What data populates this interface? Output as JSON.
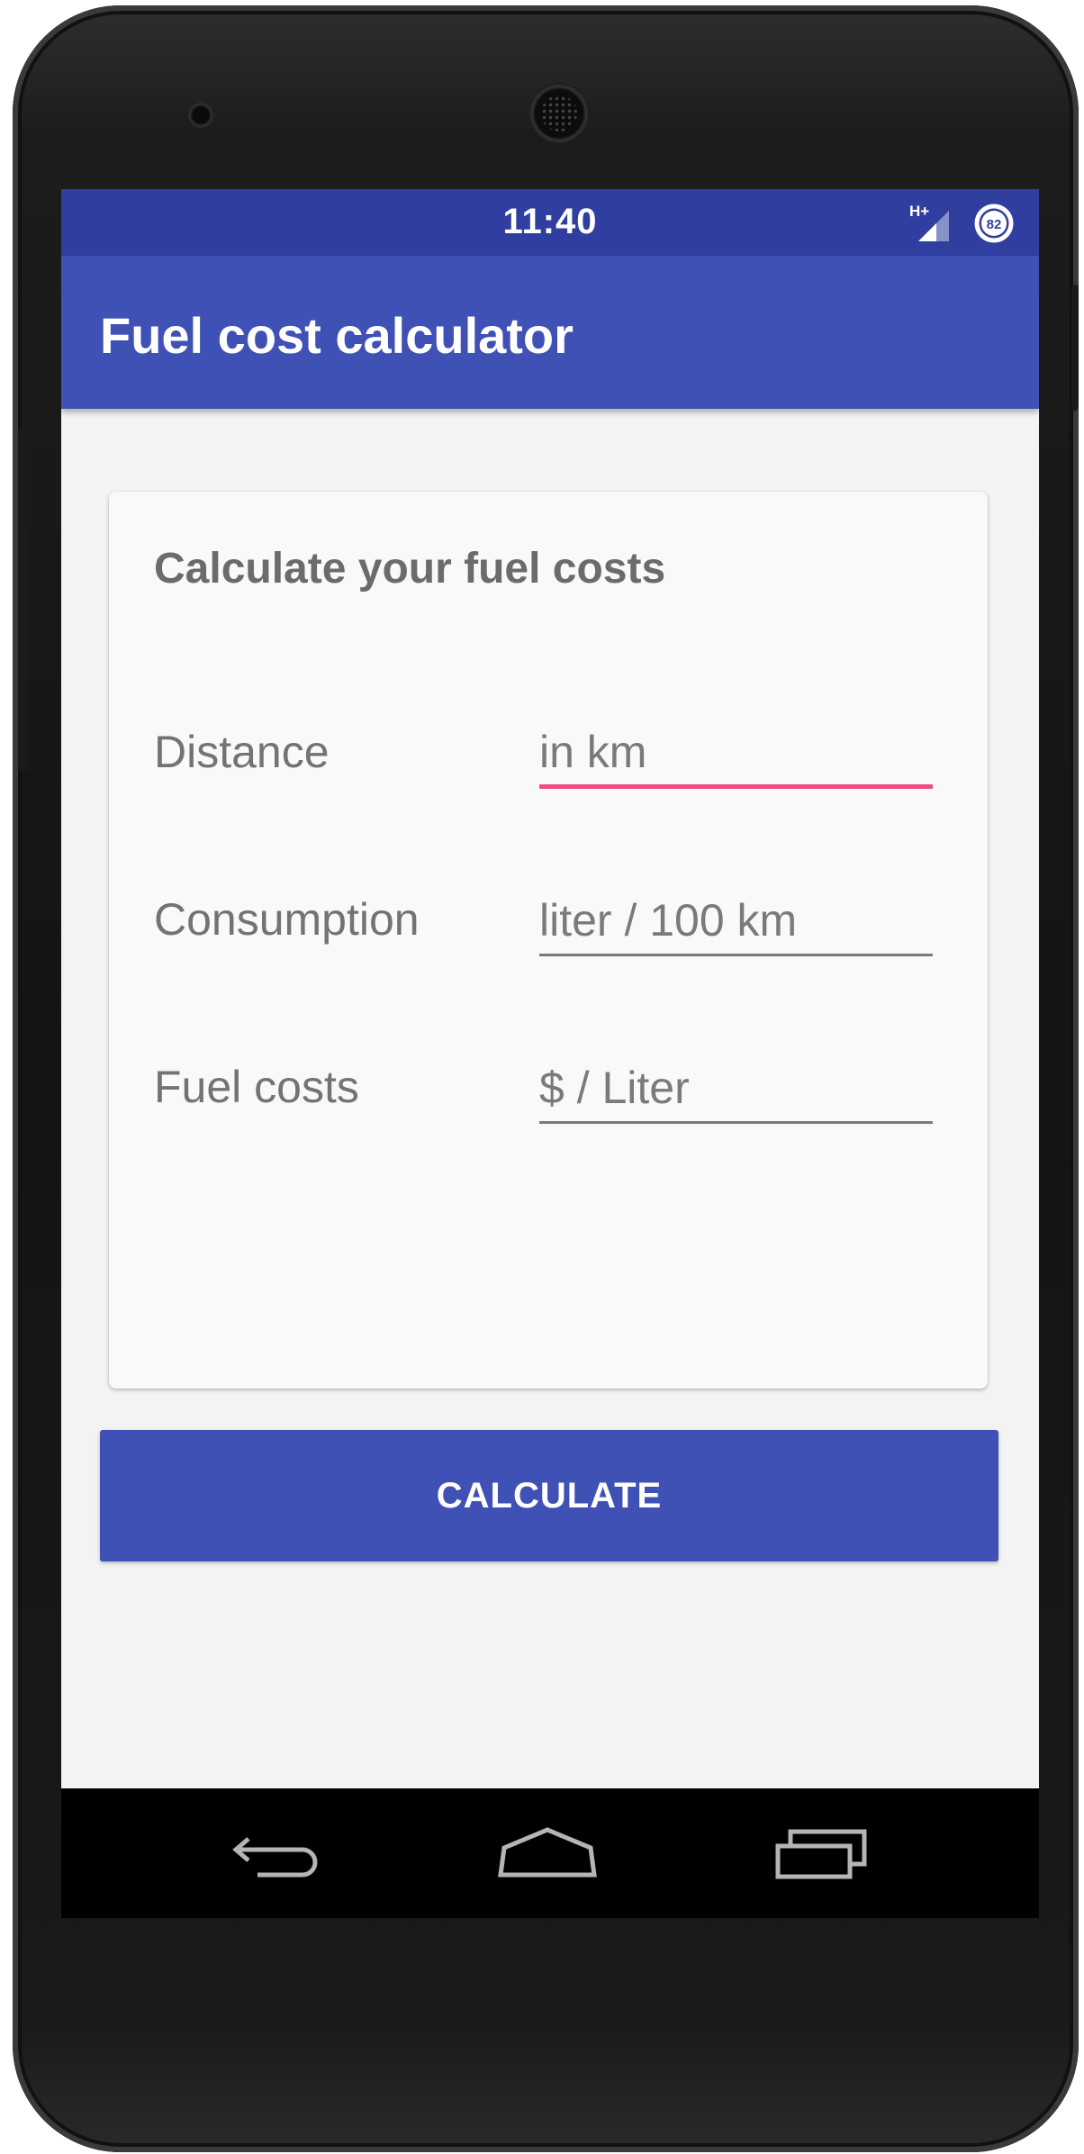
{
  "status_bar": {
    "time": "11:40",
    "network_type": "H+",
    "battery_level": "82",
    "icons": [
      "signal-icon",
      "battery-icon"
    ]
  },
  "app_bar": {
    "title": "Fuel cost calculator"
  },
  "card": {
    "title": "Calculate your fuel costs",
    "fields": [
      {
        "label": "Distance",
        "placeholder": "in km",
        "value": "",
        "focused": true
      },
      {
        "label": "Consumption",
        "placeholder": "liter / 100 km",
        "value": "",
        "focused": false
      },
      {
        "label": "Fuel costs",
        "placeholder": "$ / Liter",
        "value": "",
        "focused": false
      }
    ]
  },
  "calculate_button": {
    "label": "CALCULATE"
  },
  "nav_bar": {
    "icons": [
      "back-icon",
      "home-icon",
      "recents-icon"
    ]
  },
  "colors": {
    "status_bar": "#303f9f",
    "primary": "#3f51b5",
    "accent": "#ef4d86",
    "background": "#f3f3f3",
    "card": "#f9f9f9",
    "text_secondary": "#737373"
  }
}
